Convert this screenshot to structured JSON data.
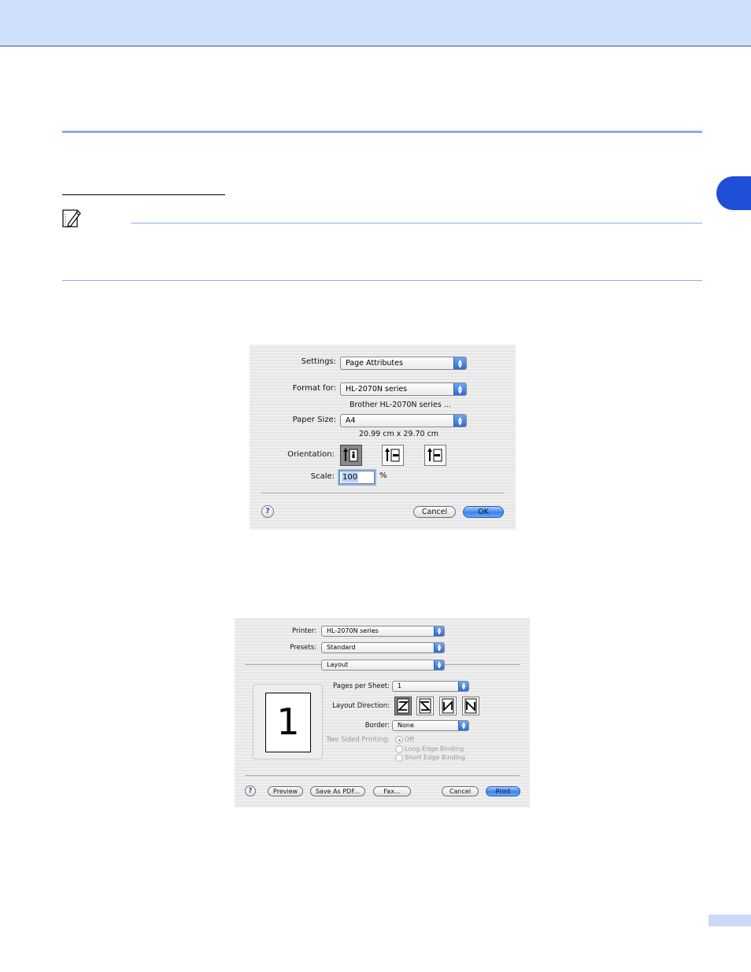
{
  "page_setup": {
    "settings_label": "Settings:",
    "settings_value": "Page Attributes",
    "format_for_label": "Format for:",
    "format_for_value": "HL-2070N series",
    "printer_description": "Brother HL-2070N series ...",
    "paper_size_label": "Paper Size:",
    "paper_size_value": "A4",
    "paper_dimensions": "20.99 cm x 29.70 cm",
    "orientation_label": "Orientation:",
    "scale_label": "Scale:",
    "scale_value": "100",
    "scale_unit": "%",
    "help_label": "?",
    "cancel_label": "Cancel",
    "ok_label": "OK"
  },
  "print_dialog": {
    "printer_label": "Printer:",
    "printer_value": "HL-2070N series",
    "presets_label": "Presets:",
    "presets_value": "Standard",
    "panel_value": "Layout",
    "preview_page_number": "1",
    "pages_per_sheet_label": "Pages per Sheet:",
    "pages_per_sheet_value": "1",
    "layout_direction_label": "Layout Direction:",
    "border_label": "Border:",
    "border_value": "None",
    "two_sided_label": "Two Sided Printing:",
    "two_sided_options": [
      "Off",
      "Long-Edge Binding",
      "Short Edge Binding"
    ],
    "help_label": "?",
    "preview_label": "Preview",
    "save_pdf_label": "Save As PDF...",
    "fax_label": "Fax...",
    "cancel_label": "Cancel",
    "print_label": "Print"
  }
}
